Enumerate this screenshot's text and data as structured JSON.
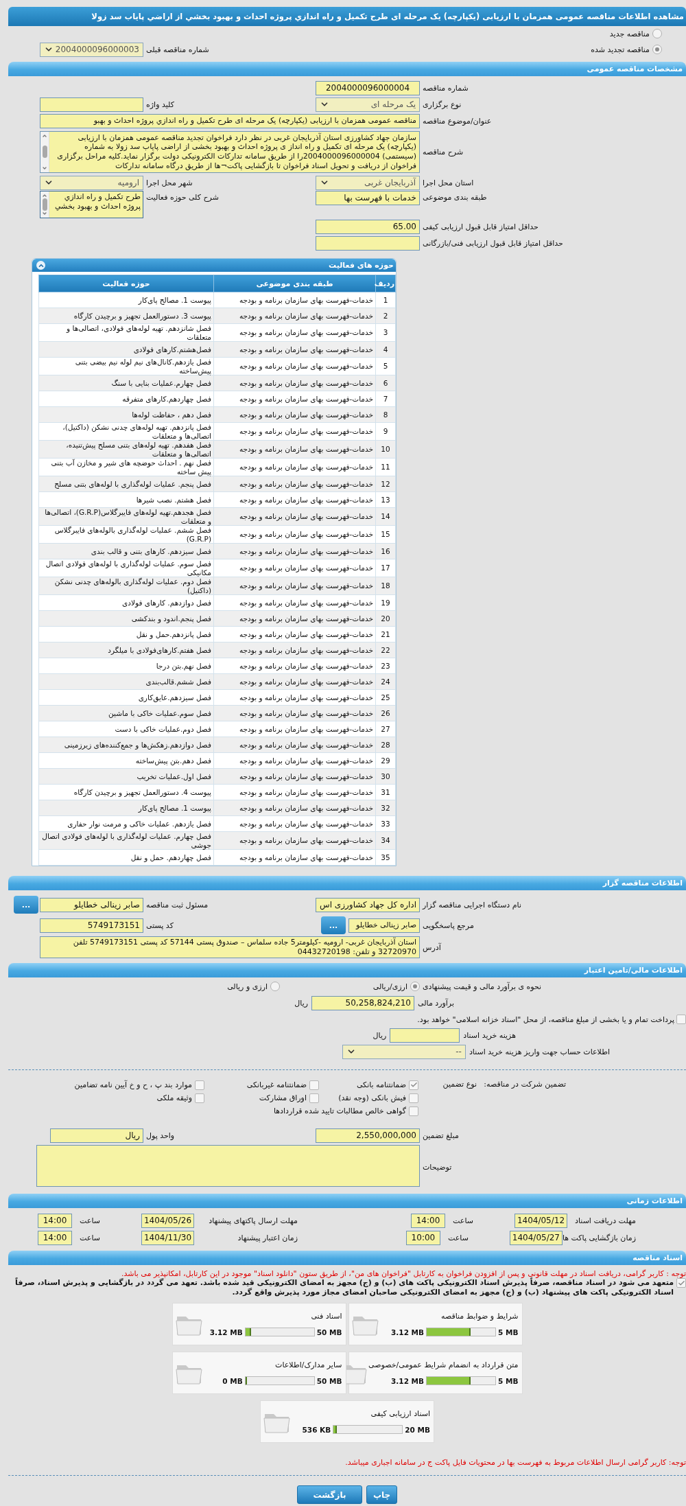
{
  "title": "مشاهده اطلاعات مناقصه عمومی همزمان با ارزیابی (یکپارچه) یک مرحله ای طرح تکمیل و راه اندازي پروژه احداث و بهبود بخشي از اراضي پاياب سد زولا",
  "tender_kind": [
    {
      "label": "مناقصه جدید",
      "selected": false
    },
    {
      "label": "مناقصه تجدید شده",
      "selected": true
    }
  ],
  "previous_number": {
    "label": "شماره مناقصه قبلی",
    "value": "2004000096000003"
  },
  "general": {
    "header": "مشخصات مناقصه عمومی",
    "number": {
      "label": "شماره مناقصه",
      "value": "2004000096000004"
    },
    "holding_type": {
      "label": "نوع برگزاری",
      "value": "یک مرحله ای"
    },
    "keyword": {
      "label": "کلید واژه"
    },
    "subject": {
      "label": "عنوان/موضوع مناقصه",
      "value": "مناقصه عمومی همزمان با ارزیابی (یکپارچه) یک مرحله ای طرح تکمیل و راه اندازي پروژه احداث و بهبو"
    },
    "description": {
      "label": "شرح مناقصه",
      "value": "سازمان جهاد کشاورزی استان آذربایجان غربی در نظر دارد فراخوان تجدید مناقصه عمومی همزمان با ارزیابی (یکپارچه) یک مرحله ای  تکمیل و راه انداز ی پروژه احداث و بهبود بخشی از اراضی پایاب سد زولا به شماره (سیستمی) 2004000096000004را از طریق سامانه تدارکات الکترونیکی دولت برگزار نماید.کلیه مراحل برگزاری فراخوان از دریافت و تحویل اسناد فراخوان تا بازگشایی پاکت¬ها از طریق درگاه سامانه تدارکات"
    },
    "province": {
      "label": "استان محل اجرا",
      "value": "آذربایجان غربی"
    },
    "city": {
      "label": "شهر محل اجرا",
      "value": "ارومیه"
    },
    "category": {
      "label": "طبقه بندی موضوعی",
      "value": "خدمات با فهرست بها"
    },
    "scope": {
      "label": "شرح کلی حوزه فعالیت",
      "value": "طرح تکمیل و راه اندازي پروژه احداث و بهبود بخشي"
    },
    "min_quality": {
      "label": "حداقل امتیاز قابل قبول ارزیابی کیفی",
      "value": "65.00"
    },
    "min_technical": {
      "label": "حداقل امتیاز قابل قبول ارزیابی فنی/بازرگانی"
    }
  },
  "activities": {
    "header": "حوزه های فعالیت",
    "columns": [
      "ردیف",
      "طبقه بندی موضوعی",
      "حوزه فعالیت"
    ],
    "rows": [
      {
        "number": "1",
        "category": "خدمات-فهرست بهای سازمان برنامه و بودجه",
        "scope": "پیوست 1. مصالح پای‌کار"
      },
      {
        "number": "2",
        "category": "خدمات-فهرست بهای سازمان برنامه و بودجه",
        "scope": "پیوست 3. دستورالعمل تجهیز و برچیدن کارگاه"
      },
      {
        "number": "3",
        "category": "خدمات-فهرست بهای سازمان برنامه و بودجه",
        "scope": "فصل شانزدهم. تهیه لوله‌های فولادی، اتصالی‌ها و متعلقات"
      },
      {
        "number": "4",
        "category": "خدمات-فهرست بهای سازمان برنامه و بودجه",
        "scope": "فصل‌هشتم.کارهای فولادی"
      },
      {
        "number": "5",
        "category": "خدمات-فهرست بهای سازمان برنامه و بودجه",
        "scope": "فصل یازدهم.کانال‌های نیم لوله نیم بیضی بتنی پیش‌ساخته"
      },
      {
        "number": "6",
        "category": "خدمات-فهرست بهای سازمان برنامه و بودجه",
        "scope": "فصل چهارم.عملیات بنایی با سنگ"
      },
      {
        "number": "7",
        "category": "خدمات-فهرست بهای سازمان برنامه و بودجه",
        "scope": "فصل چهاردهم.کارهای متفرقه"
      },
      {
        "number": "8",
        "category": "خدمات-فهرست بهای سازمان برنامه و بودجه",
        "scope": "فصل دهم ، حفاظت لوله‌ها"
      },
      {
        "number": "9",
        "category": "خدمات-فهرست بهای سازمان برنامه و بودجه",
        "scope": "فصل پانزدهم. تهیه لوله‌های چدنی نشکن (داکتیل)، اتصالی‌ها و متعلقات"
      },
      {
        "number": "10",
        "category": "خدمات-فهرست بهای سازمان برنامه و بودجه",
        "scope": "فصل هفدهم. تهیه لوله‌های بتنی مسلح پیش‌تنیده، اتصالی‌ها و متعلقات"
      },
      {
        "number": "11",
        "category": "خدمات-فهرست بهای سازمان برنامه و بودجه",
        "scope": "فصل نهم . احداث حوضچه های شیر و مخازن آب بتنی پیش ساخته"
      },
      {
        "number": "12",
        "category": "خدمات-فهرست بهای سازمان برنامه و بودجه",
        "scope": "فصل پنجم. عملیات لوله‌گذاری با لوله‌های بتنی مسلح"
      },
      {
        "number": "13",
        "category": "خدمات-فهرست بهای سازمان برنامه و بودجه",
        "scope": "فصل هشتم. نصب شیرها"
      },
      {
        "number": "14",
        "category": "خدمات-فهرست بهای سازمان برنامه و بودجه",
        "scope": "فصل هجدهم.تهیه لوله‌های فایبرگلاس(G.R.P)، اتصالی‌ها و متعلقات"
      },
      {
        "number": "15",
        "category": "خدمات-فهرست بهای سازمان برنامه و بودجه",
        "scope": "فصل ششم. عملیات لوله‌گذاری بالوله‌های فایبرگلاس (G.R.P)"
      },
      {
        "number": "16",
        "category": "خدمات-فهرست بهای سازمان برنامه و بودجه",
        "scope": "فصل سیزدهم. کارهای بتنی و قالب بندی"
      },
      {
        "number": "17",
        "category": "خدمات-فهرست بهای سازمان برنامه و بودجه",
        "scope": "فصل سوم. عملیات لوله‌گذاری با لوله‌های فولادی اتصال مکانیکی"
      },
      {
        "number": "18",
        "category": "خدمات-فهرست بهای سازمان برنامه و بودجه",
        "scope": "فصل دوم. عملیات لوله‌گذاری بالوله‌های چدنی نشکن (داکتیل)"
      },
      {
        "number": "19",
        "category": "خدمات-فهرست بهای سازمان برنامه و بودجه",
        "scope": "فصل دوازدهم. کارهای فولادی"
      },
      {
        "number": "20",
        "category": "خدمات-فهرست بهای سازمان برنامه و بودجه",
        "scope": "فصل پنجم.اندود و بندکشی"
      },
      {
        "number": "21",
        "category": "خدمات-فهرست بهای سازمان برنامه و بودجه",
        "scope": "فصل پانزدهم.حمل و نقل"
      },
      {
        "number": "22",
        "category": "خدمات-فهرست بهای سازمان برنامه و بودجه",
        "scope": "فصل هفتم.کارهای‌فولادی با میلگرد"
      },
      {
        "number": "23",
        "category": "خدمات-فهرست بهای سازمان برنامه و بودجه",
        "scope": "فصل نهم.بتن درجا"
      },
      {
        "number": "24",
        "category": "خدمات-فهرست بهای سازمان برنامه و بودجه",
        "scope": "فصل ششم.قالب‌بندی"
      },
      {
        "number": "25",
        "category": "خدمات-فهرست بهای سازمان برنامه و بودجه",
        "scope": "فصل سیزدهم.عایق‌کاری"
      },
      {
        "number": "26",
        "category": "خدمات-فهرست بهای سازمان برنامه و بودجه",
        "scope": "فصل سوم.عملیات خاکی با ماشین"
      },
      {
        "number": "27",
        "category": "خدمات-فهرست بهای سازمان برنامه و بودجه",
        "scope": "فصل دوم.عملیات خاکی با دست"
      },
      {
        "number": "28",
        "category": "خدمات-فهرست بهای سازمان برنامه و بودجه",
        "scope": "فصل دوازدهم.زهکش‌ها و جمع‌کننده‌های زیرزمینی"
      },
      {
        "number": "29",
        "category": "خدمات-فهرست بهای سازمان برنامه و بودجه",
        "scope": "فصل دهم.بتن پیش‌ساخته"
      },
      {
        "number": "30",
        "category": "خدمات-فهرست بهای سازمان برنامه و بودجه",
        "scope": "فصل اول.عملیات تخریب"
      },
      {
        "number": "31",
        "category": "خدمات-فهرست بهای سازمان برنامه و بودجه",
        "scope": "پیوست 4. دستورالعمل تجهیز و برچیدن کارگاه"
      },
      {
        "number": "32",
        "category": "خدمات-فهرست بهای سازمان برنامه و بودجه",
        "scope": "پیوست 1. مصالح پای‌کار"
      },
      {
        "number": "33",
        "category": "خدمات-فهرست بهای سازمان برنامه و بودجه",
        "scope": "فصل یازدهم. عملیات خاکی و مرمت نوار حفاری"
      },
      {
        "number": "34",
        "category": "خدمات-فهرست بهای سازمان برنامه و بودجه",
        "scope": "فصل چهارم. عملیات لوله‌گذاری با لوله‌های فولادی اتصال جوشی"
      },
      {
        "number": "35",
        "category": "خدمات-فهرست بهای سازمان برنامه و بودجه",
        "scope": "فصل چهاردهم. حمل و نقل"
      }
    ]
  },
  "organizer": {
    "header": "اطلاعات مناقصه گزار",
    "executive": {
      "label": "نام دستگاه اجرایی مناقصه گزار",
      "value": "اداره کل جهاد کشاورزی اس"
    },
    "registrar": {
      "label": "مسئول ثبت مناقصه",
      "value": "صابر زینالی خطایلو",
      "button": "..."
    },
    "responder": {
      "label": "مرجع پاسخگویی",
      "value": "صابر زینالی خطایلو",
      "button": "..."
    },
    "postal_code": {
      "label": "کد پستی",
      "value": "5749173151"
    },
    "address": {
      "label": "آدرس",
      "value": "استان آذربایجان غربی- ارومیه -کیلومتر5  جاده سلماس  – صندوق پستی 57144 کد پستی   5749173151 تلفن 32720970 و تلفن: 04432720198"
    }
  },
  "financial": {
    "header": "اطلاعات مالی/تامین اعتبار",
    "estimate_method": {
      "label": "نحوه ی برآورد مالی و قیمت پیشنهادی",
      "options": [
        {
          "label": "ارزی/ریالی",
          "selected": true
        },
        {
          "label": "ارزی و ریالی",
          "selected": false
        }
      ]
    },
    "estimate": {
      "label": "برآورد مالی",
      "value": "50,258,824,210",
      "unit": "ریال"
    },
    "treasury": {
      "label": "پرداخت تمام و یا بخشی از مبلغ مناقصه، از محل \"اسناد خزانه اسلامی\" خواهد بود.",
      "checked": false
    },
    "doc_fee": {
      "label": "هزینه خرید اسناد",
      "unit": "ریال"
    },
    "account": {
      "label": "اطلاعات حساب جهت واریز هزینه خرید اسناد",
      "value": "--"
    },
    "guarantee": {
      "label": "تضمین شرکت در مناقصه:",
      "type_label": "نوع تضمین",
      "options": [
        {
          "label": "ضمانتنامه بانکی",
          "checked": true
        },
        {
          "label": "ضمانتنامه غیربانکی",
          "checked": false
        },
        {
          "label": "موارد بند پ ، ح و خ آیین نامه تضامین",
          "checked": false
        },
        {
          "label": "فیش بانکی (وجه نقد)",
          "checked": false
        },
        {
          "label": "اوراق مشارکت",
          "checked": false
        },
        {
          "label": "وثیقه ملکی",
          "checked": false
        },
        {
          "label": "گواهی خالص مطالبات تایید شده قراردادها",
          "checked": false
        }
      ]
    },
    "amount": {
      "label": "مبلغ تضمین",
      "value": "2,550,000,000"
    },
    "currency": {
      "label": "واحد پول",
      "value": "ریال"
    },
    "notes": {
      "label": "توضیحات"
    }
  },
  "timing": {
    "header": "اطلاعات زمانی",
    "items": [
      {
        "label": "مهلت دریافت اسناد",
        "date": "1404/05/12",
        "time_label": "ساعت",
        "time": "14:00"
      },
      {
        "label": "مهلت ارسال پاکتهای پیشنهاد",
        "date": "1404/05/26",
        "time_label": "ساعت",
        "time": "14:00"
      },
      {
        "label": "زمان بازگشایی پاکت ها",
        "date": "1404/05/27",
        "time_label": "ساعت",
        "time": "10:00"
      },
      {
        "label": "زمان اعتبار پیشنهاد",
        "date": "1404/11/30",
        "time_label": "ساعت",
        "time": "14:00"
      }
    ]
  },
  "documents": {
    "header": "اسناد مناقصه",
    "notice": "توجه : کاربر گرامی، دریافت اسناد در مهلت قانونی و پس از افزودن فراخوان به کارتابل \"فراخوان های من\"، از طریق ستون \"دانلود اسناد\" موجود در این کارتابل، امکانپذیر می باشد.",
    "commitment": {
      "text": "متعهد می شود در اسناد مناقصه، صرفاً پذیرش اسناد الکترونیکی پاکت های (ب) و (ج) مجهز به امضای الکترونیکی قید شده باشد. تعهد می گردد در بازگشایی و پذیرش اسناد، صرفاً اسناد الکترونیکی پاکت های پیشنهاد (ب) و (ج) مجهز به امضای الکترونیکی صاحبان امضای مجاز مورد پذیرش واقع گردد.",
      "checked": true
    },
    "files": [
      {
        "name": "شرایط و ضوابط مناقصه",
        "used": "3.12 MB",
        "max": "5 MB",
        "level": 0.62
      },
      {
        "name": "اسناد فنی",
        "used": "3.12 MB",
        "max": "50 MB",
        "level": 0.06
      },
      {
        "name": "متن قرارداد به انضمام شرایط عمومی/خصوصی",
        "used": "3.12 MB",
        "max": "5 MB",
        "level": 0.62
      },
      {
        "name": "سایر مدارک/اطلاعات",
        "used": "0 MB",
        "max": "50 MB",
        "level": 0
      },
      {
        "name": "اسناد ارزیابی کیفی",
        "used": "536 KB",
        "max": "20 MB",
        "level": 0.03
      }
    ],
    "footer_note": "توجه: کاربر گرامی ارسال اطلاعات مربوط به فهرست بها در محتویات فایل پاکت ج در سامانه اجباری میباشد."
  },
  "buttons": [
    "چاپ",
    "بازگشت"
  ]
}
